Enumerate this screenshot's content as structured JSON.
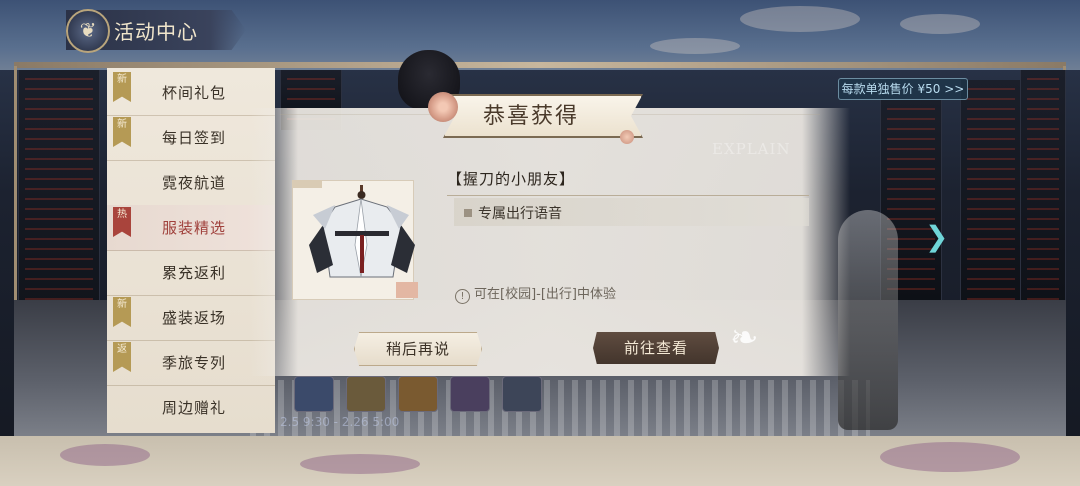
{
  "header": {
    "title": "活动中心"
  },
  "menu": {
    "items": [
      {
        "label": "杯间礼包",
        "tag": "新"
      },
      {
        "label": "每日签到",
        "tag": "新"
      },
      {
        "label": "霓夜航道",
        "tag": ""
      },
      {
        "label": "服装精选",
        "tag": "热",
        "selected": true
      },
      {
        "label": "累充返利",
        "tag": ""
      },
      {
        "label": "盛装返场",
        "tag": "新"
      },
      {
        "label": "季旅专列",
        "tag": "返"
      },
      {
        "label": "周边赠礼",
        "tag": ""
      }
    ]
  },
  "background": {
    "price_tag": "每款单独售价 ¥50 >>",
    "explain_text": "EXPLAIN",
    "date_range": "2.5 9:30 - 2.26 5:00"
  },
  "modal": {
    "title": "恭喜获得",
    "reward_name": "【握刀的小朋友】",
    "reward_detail": "专属出行语音",
    "tip": "可在[校园]-[出行]中体验",
    "later_button": "稍后再说",
    "go_button": "前往查看"
  },
  "colors": {
    "accent_dark": "#4a3a2b",
    "selected_text": "#a0413c",
    "tag_new": "#b59a55",
    "tag_hot": "#a9443c"
  }
}
